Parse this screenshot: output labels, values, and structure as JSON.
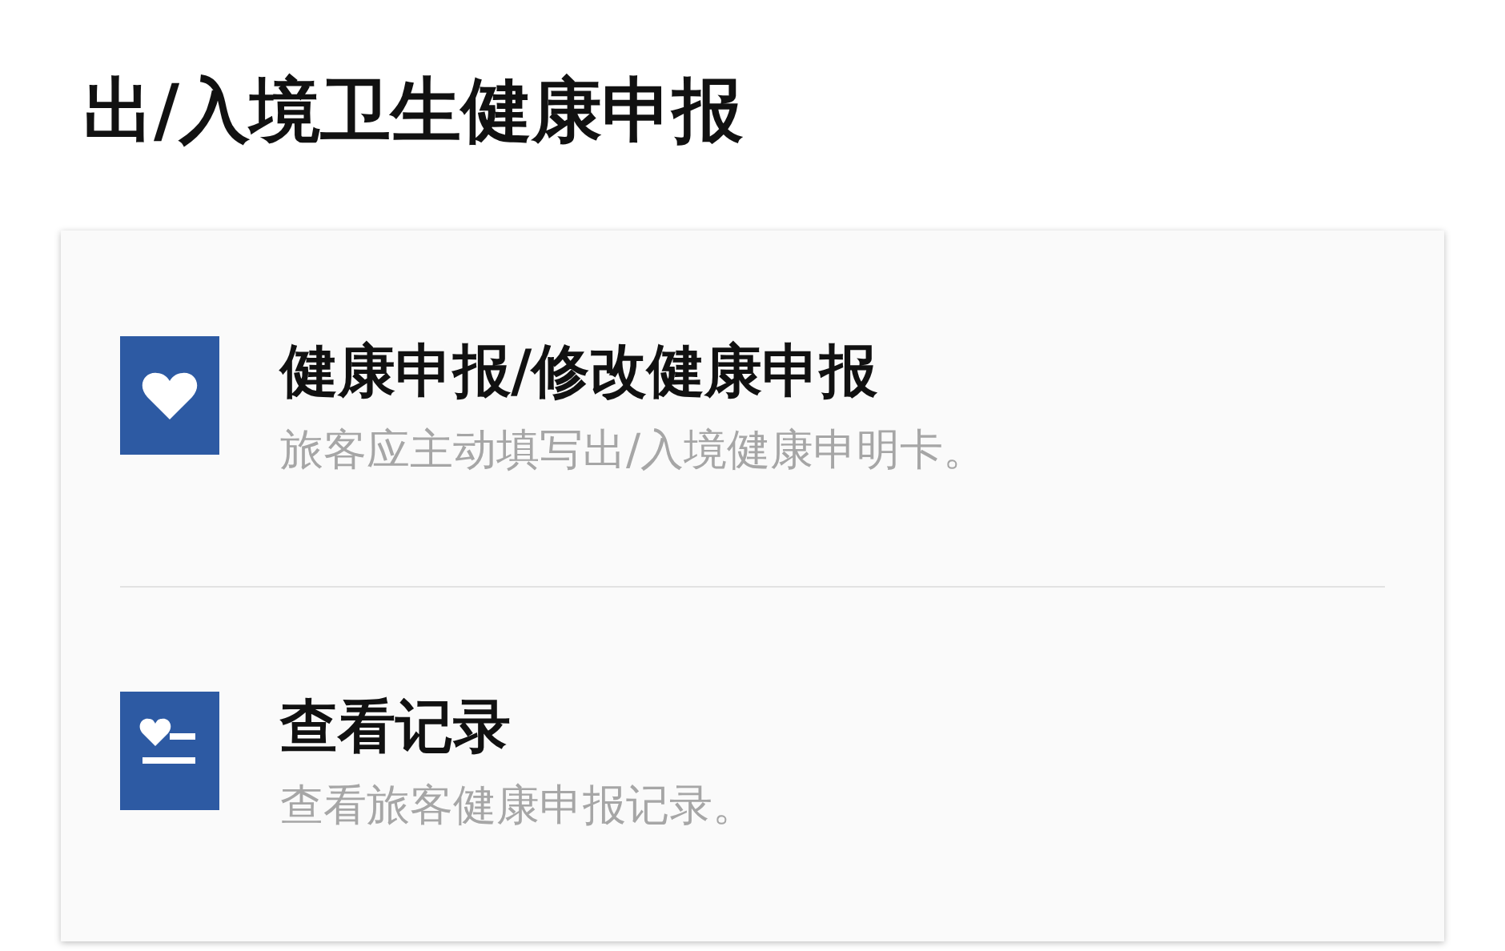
{
  "title": "出/入境卫生健康申报",
  "items": [
    {
      "kind": "heart",
      "label": "健康申报/修改健康申报",
      "description": "旅客应主动填写出/入境健康申明卡。"
    },
    {
      "kind": "record",
      "label": "查看记录",
      "description": "查看旅客健康申报记录。"
    }
  ]
}
